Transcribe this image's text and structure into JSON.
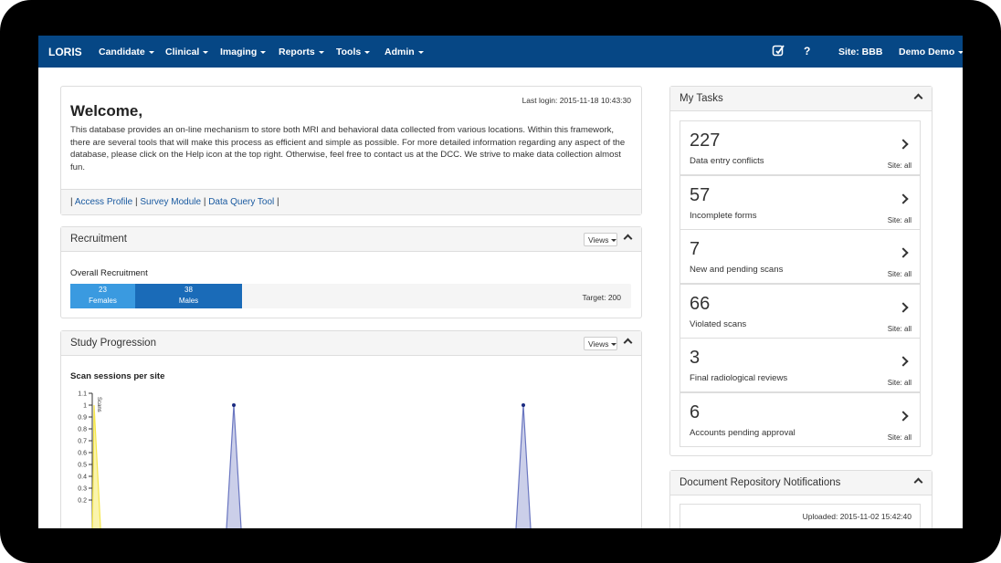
{
  "navbar": {
    "brand": "LORIS",
    "menus": [
      "Candidate",
      "Clinical",
      "Imaging",
      "Reports",
      "Tools",
      "Admin"
    ],
    "site": "Site: BBB",
    "user": "Demo Demo",
    "icons": [
      "edit-icon",
      "help-icon"
    ],
    "color": "#064785"
  },
  "welcome": {
    "title": "Welcome,",
    "last_login": "Last login: 2015-11-18 10:43:30",
    "body": "This database provides an on-line mechanism to store both MRI and behavioral data collected from various locations. Within this framework, there are several tools that will make this process as efficient and simple as possible. For more detailed information regarding any aspect of the database, please click on the Help icon at the top right. Otherwise, feel free to contact us at the DCC. We strive to make data collection almost fun.",
    "links": [
      "Access Profile",
      "Survey Module",
      "Data Query Tool"
    ]
  },
  "recruitment": {
    "title": "Recruitment",
    "views_label": "Views",
    "overall_label": "Overall Recruitment",
    "females": {
      "count": "23",
      "label": "Females",
      "fraction": 0.115,
      "color": "#3a9ae0"
    },
    "males": {
      "count": "38",
      "label": "Males",
      "fraction": 0.19,
      "color": "#1a6bb8"
    },
    "target": "Target: 200"
  },
  "study_progression": {
    "title": "Study Progression",
    "views_label": "Views",
    "chart_title": "Scan sessions per site"
  },
  "chart_data": {
    "type": "area",
    "title": "Scan sessions per site",
    "y_ticks": [
      "1.1",
      "1",
      "0.9",
      "0.8",
      "0.7",
      "0.6",
      "0.5",
      "0.4",
      "0.3",
      "0.2"
    ],
    "ylim": [
      0.2,
      1.1
    ],
    "series_label": "Scans",
    "series": [
      {
        "name": "",
        "color": "#f5e64a",
        "peaks": [
          1.0
        ]
      },
      {
        "name": "",
        "color": "#6a76c0",
        "peaks": [
          1.0,
          1.0
        ]
      }
    ]
  },
  "tasks": {
    "title": "My Tasks",
    "items": [
      {
        "count": "227",
        "label": "Data entry conflicts",
        "site": "Site: all"
      },
      {
        "count": "57",
        "label": "Incomplete forms",
        "site": "Site: all"
      },
      {
        "count": "7",
        "label": "New and pending scans",
        "site": "Site: all"
      },
      {
        "count": "66",
        "label": "Violated scans",
        "site": "Site: all"
      },
      {
        "count": "3",
        "label": "Final radiological reviews",
        "site": "Site: all"
      },
      {
        "count": "6",
        "label": "Accounts pending approval",
        "site": "Site: all"
      }
    ]
  },
  "documents": {
    "title": "Document Repository Notifications",
    "uploaded": "Uploaded: 2015-11-02 15:42:40"
  }
}
